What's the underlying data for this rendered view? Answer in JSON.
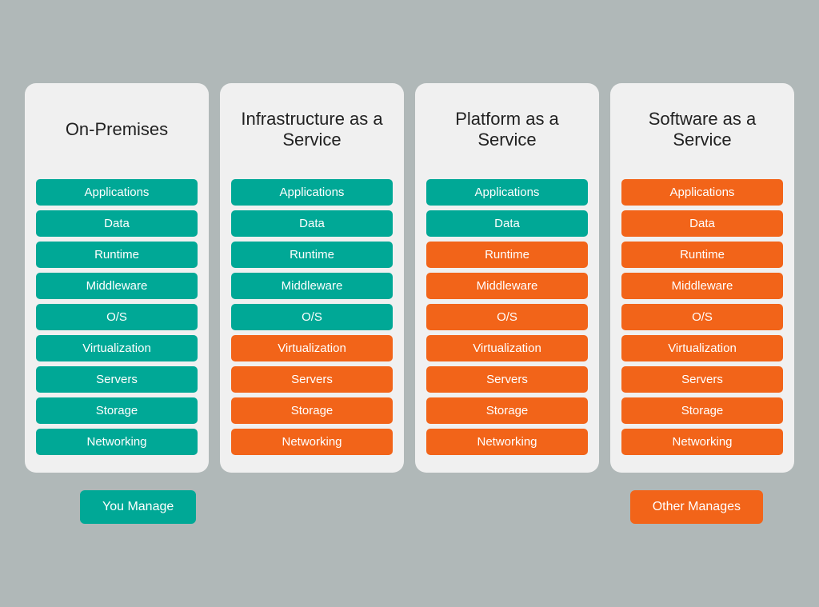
{
  "columns": [
    {
      "id": "on-premises",
      "title": "On-Premises",
      "items": [
        {
          "label": "Applications",
          "color": "teal"
        },
        {
          "label": "Data",
          "color": "teal"
        },
        {
          "label": "Runtime",
          "color": "teal"
        },
        {
          "label": "Middleware",
          "color": "teal"
        },
        {
          "label": "O/S",
          "color": "teal"
        },
        {
          "label": "Virtualization",
          "color": "teal"
        },
        {
          "label": "Servers",
          "color": "teal"
        },
        {
          "label": "Storage",
          "color": "teal"
        },
        {
          "label": "Networking",
          "color": "teal"
        }
      ]
    },
    {
      "id": "infrastructure-as-a-service",
      "title": "Infrastructure as a Service",
      "items": [
        {
          "label": "Applications",
          "color": "teal"
        },
        {
          "label": "Data",
          "color": "teal"
        },
        {
          "label": "Runtime",
          "color": "teal"
        },
        {
          "label": "Middleware",
          "color": "teal"
        },
        {
          "label": "O/S",
          "color": "teal"
        },
        {
          "label": "Virtualization",
          "color": "orange"
        },
        {
          "label": "Servers",
          "color": "orange"
        },
        {
          "label": "Storage",
          "color": "orange"
        },
        {
          "label": "Networking",
          "color": "orange"
        }
      ]
    },
    {
      "id": "platform-as-a-service",
      "title": "Platform as a Service",
      "items": [
        {
          "label": "Applications",
          "color": "teal"
        },
        {
          "label": "Data",
          "color": "teal"
        },
        {
          "label": "Runtime",
          "color": "orange"
        },
        {
          "label": "Middleware",
          "color": "orange"
        },
        {
          "label": "O/S",
          "color": "orange"
        },
        {
          "label": "Virtualization",
          "color": "orange"
        },
        {
          "label": "Servers",
          "color": "orange"
        },
        {
          "label": "Storage",
          "color": "orange"
        },
        {
          "label": "Networking",
          "color": "orange"
        }
      ]
    },
    {
      "id": "software-as-a-service",
      "title": "Software as a Service",
      "items": [
        {
          "label": "Applications",
          "color": "orange"
        },
        {
          "label": "Data",
          "color": "orange"
        },
        {
          "label": "Runtime",
          "color": "orange"
        },
        {
          "label": "Middleware",
          "color": "orange"
        },
        {
          "label": "O/S",
          "color": "orange"
        },
        {
          "label": "Virtualization",
          "color": "orange"
        },
        {
          "label": "Servers",
          "color": "orange"
        },
        {
          "label": "Storage",
          "color": "orange"
        },
        {
          "label": "Networking",
          "color": "orange"
        }
      ]
    }
  ],
  "legend": {
    "you_manage_label": "You Manage",
    "other_manages_label": "Other Manages"
  }
}
